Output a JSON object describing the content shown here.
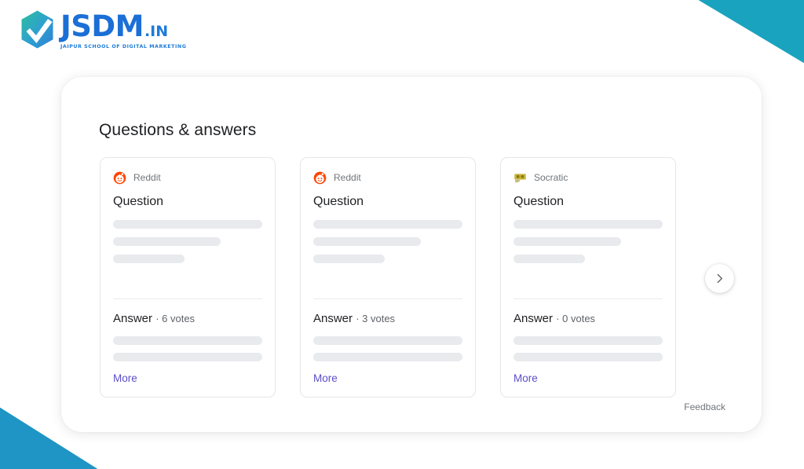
{
  "brand": {
    "name": "JSDM",
    "tld": ".IN",
    "tagline": "JAIPUR SCHOOL OF DIGITAL MARKETING",
    "logo_gradient_start": "#2BBF9E",
    "logo_gradient_end": "#2E7FD4",
    "text_color": "#1B6FD6"
  },
  "decor": {
    "top_right_color": "#1AA3BE",
    "bottom_left_color": "#1E95C4"
  },
  "panel": {
    "title": "Questions & answers",
    "feedback_label": "Feedback",
    "next_button_icon": "chevron-right-icon"
  },
  "cards": [
    {
      "source": "Reddit",
      "source_icon": "reddit-icon",
      "question_label": "Question",
      "answer_label": "Answer",
      "votes_text": "· 6 votes",
      "more_label": "More"
    },
    {
      "source": "Reddit",
      "source_icon": "reddit-icon",
      "question_label": "Question",
      "answer_label": "Answer",
      "votes_text": "· 3 votes",
      "more_label": "More"
    },
    {
      "source": "Socratic",
      "source_icon": "socratic-icon",
      "question_label": "Question",
      "answer_label": "Answer",
      "votes_text": "· 0 votes",
      "more_label": "More"
    }
  ],
  "colors": {
    "more_link": "#5c4ec9",
    "skeleton": "#e8eaed",
    "card_border": "#e4e6e8"
  }
}
